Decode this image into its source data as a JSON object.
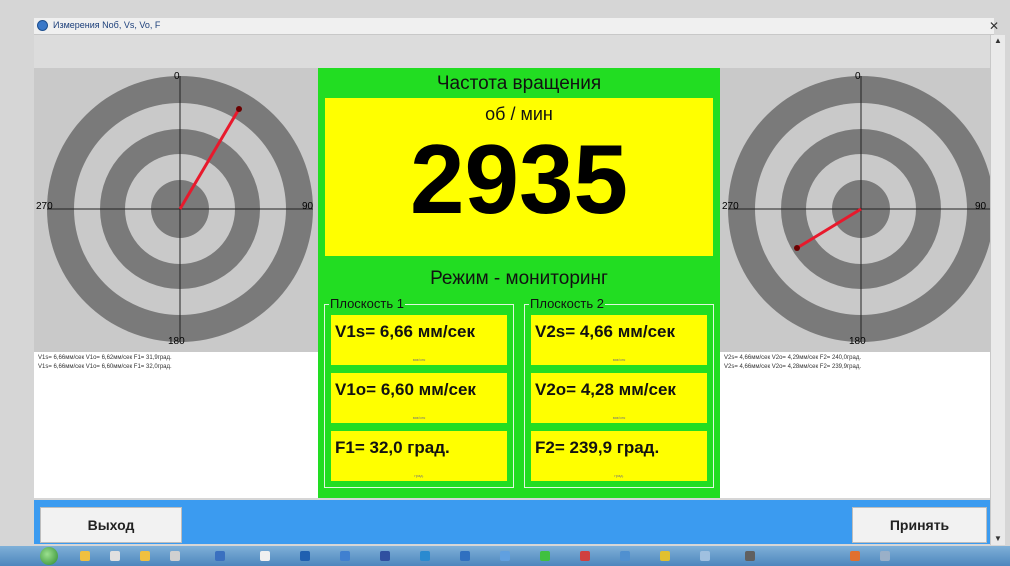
{
  "window": {
    "title": "Измерения Nоб, Vs, Vo, F"
  },
  "center": {
    "title": "Частота вращения",
    "unit": "об / мин",
    "rpm": "2935",
    "mode": "Режим - мониторинг"
  },
  "left_dial": {
    "label_top": "0",
    "label_left": "270",
    "label_right": "90",
    "label_bottom": "180",
    "readings": [
      "V1s= 6,66мм/сек   V1o= 6,62мм/сек   F1= 31,9град.",
      "V1s= 6,66мм/сек   V1o= 6,60мм/сек   F1= 32,0град."
    ]
  },
  "right_dial": {
    "label_top": "0",
    "label_left": "270",
    "label_right": "90",
    "label_bottom": "180",
    "readings": [
      "V2s= 4,66мм/сек   V2o= 4,29мм/сек   F2= 240,0град.",
      "V2s= 4,66мм/сек   V2o= 4,28мм/сек   F2= 239,9град."
    ]
  },
  "plane1": {
    "label": "Плоскость 1",
    "v_s": "V1s= 6,66 мм/сек",
    "v_o": "V1o= 6,60 мм/сек",
    "f": "F1= 32,0 град.",
    "sub": "мм/сек",
    "sub_f": "град."
  },
  "plane2": {
    "label": "Плоскость 2",
    "v_s": "V2s= 4,66 мм/сек",
    "v_o": "V2o= 4,28 мм/сек",
    "f": "F2= 239,9 град.",
    "sub": "мм/сек",
    "sub_f": "град."
  },
  "buttons": {
    "exit": "Выход",
    "accept": "Принять"
  },
  "icons": {
    "close": "close-icon",
    "app": "app-icon"
  },
  "colors": {
    "panel_green": "#22dd22",
    "display_yellow": "#ffff00",
    "bottom_bar": "#3b9bf0",
    "vector_red": "#e8192c",
    "ring_dark": "#7a7a7a",
    "ring_light": "#c9c9c9"
  }
}
